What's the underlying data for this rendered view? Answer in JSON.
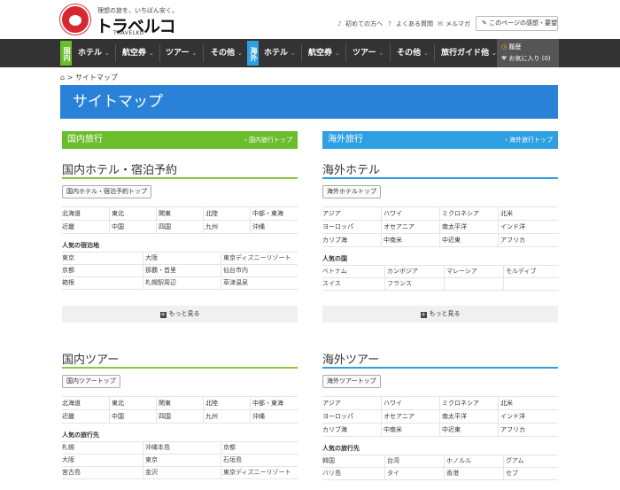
{
  "header": {
    "tagline": "理想の旅を、いちばん安く。",
    "logo_main": "トラベルコ",
    "logo_sub": "TRAVELKO",
    "links": [
      {
        "icon": "♪",
        "label": "初めての方へ"
      },
      {
        "icon": "?",
        "label": "よくある質問"
      },
      {
        "icon": "✉",
        "label": "メルマガ"
      }
    ],
    "feedback": "✎ このページの感想・要望"
  },
  "nav": {
    "dom_flag": "国内",
    "int_flag": "海外",
    "dom_items": [
      "ホテル",
      "航空券",
      "ツアー",
      "その他"
    ],
    "int_items": [
      "ホテル",
      "航空券",
      "ツアー",
      "その他"
    ],
    "guide": "旅行ガイド他",
    "history": "履歴",
    "favorites": "お気に入り (0)"
  },
  "breadcrumb": {
    "home": "⌂",
    "sep": ">",
    "current": "サイトマップ"
  },
  "page_title": "サイトマップ",
  "domestic": {
    "head": "国内旅行",
    "link": "› 国内旅行トップ"
  },
  "overseas": {
    "head": "海外旅行",
    "link": "› 海外旅行トップ"
  },
  "dom_hotel": {
    "title": "国内ホテル・宿泊予約",
    "button": "国内ホテル・宿泊予約トップ",
    "regions": [
      [
        "北海道",
        "東北",
        "関東",
        "北陸",
        "中部・東海"
      ],
      [
        "近畿",
        "中国",
        "四国",
        "九州",
        "沖縄"
      ]
    ],
    "popular_label": "人気の宿泊地",
    "popular": [
      [
        "東京",
        "大阪",
        "東京ディズニーリゾート"
      ],
      [
        "京都",
        "那覇・首里",
        "仙台市内"
      ],
      [
        "箱根",
        "札幌駅周辺",
        "草津温泉"
      ]
    ],
    "more": "もっと見る"
  },
  "int_hotel": {
    "title": "海外ホテル",
    "button": "海外ホテルトップ",
    "regions": [
      [
        "アジア",
        "ハワイ",
        "ミクロネシア",
        "北米"
      ],
      [
        "ヨーロッパ",
        "オセアニア",
        "南太平洋",
        "インド洋"
      ],
      [
        "カリブ海",
        "中南米",
        "中近東",
        "アフリカ"
      ]
    ],
    "popular_label": "人気の国",
    "popular": [
      [
        "ベトナム",
        "カンボジア",
        "マレーシア",
        "モルディブ"
      ],
      [
        "スイス",
        "フランス",
        "",
        ""
      ]
    ],
    "more": "もっと見る"
  },
  "dom_tour": {
    "title": "国内ツアー",
    "button": "国内ツアートップ",
    "regions": [
      [
        "北海道",
        "東北",
        "関東",
        "北陸",
        "中部・東海"
      ],
      [
        "近畿",
        "中国",
        "四国",
        "九州",
        "沖縄"
      ]
    ],
    "popular_label": "人気の旅行先",
    "popular": [
      [
        "札幌",
        "沖縄本島",
        "京都"
      ],
      [
        "大阪",
        "東京",
        "石垣島"
      ],
      [
        "宮古島",
        "金沢",
        "東京ディズニーリゾート"
      ]
    ]
  },
  "int_tour": {
    "title": "海外ツアー",
    "button": "海外ツアートップ",
    "regions": [
      [
        "アジア",
        "ハワイ",
        "ミクロネシア",
        "北米"
      ],
      [
        "ヨーロッパ",
        "オセアニア",
        "南太平洋",
        "インド洋"
      ],
      [
        "カリブ海",
        "中南米",
        "中近東",
        "アフリカ"
      ]
    ],
    "popular_label": "人気の旅行先",
    "popular": [
      [
        "韓国",
        "台湾",
        "ホノルル",
        "グアム"
      ],
      [
        "バリ島",
        "タイ",
        "香港",
        "セブ"
      ]
    ]
  },
  "colors": {
    "domestic": "#6abd2b",
    "overseas": "#2f9fe3",
    "title_bar": "#2a82d8",
    "nav_bg": "#333333"
  }
}
